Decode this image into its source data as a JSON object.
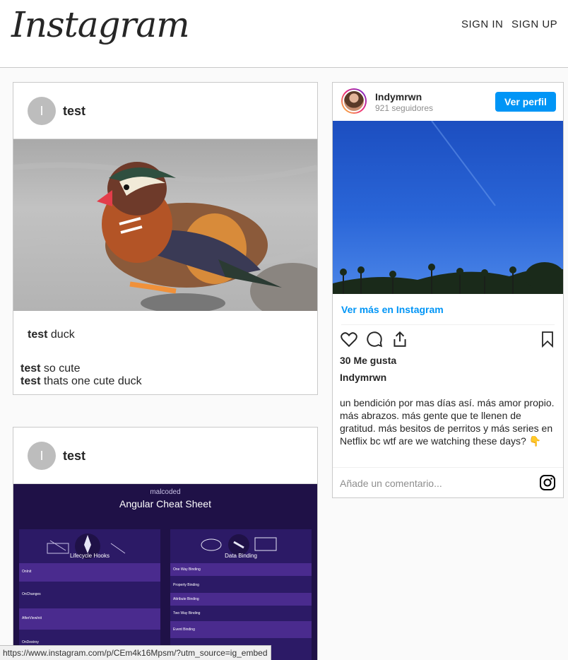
{
  "header": {
    "logo": "Instagram",
    "sign_in": "SIGN IN",
    "sign_up": "SIGN UP"
  },
  "posts": [
    {
      "avatar_letter": "I",
      "username": "test",
      "image_icon": "mandarin-duck-photo",
      "caption": {
        "user": "test",
        "text": " duck"
      },
      "comments": [
        {
          "user": "test",
          "text": " so cute"
        },
        {
          "user": "test",
          "text": " thats one cute duck"
        }
      ]
    },
    {
      "avatar_letter": "I",
      "username": "test",
      "sheet": {
        "brand": "malcoded",
        "title": "Angular Cheat Sheet",
        "left_heading": "Lifecycle Hooks",
        "right_heading": "Data Binding",
        "left_rows": [
          "OnInit",
          "OnChanges",
          "AfterViewInit",
          "OnDestroy"
        ],
        "right_rows": [
          "One Way Binding",
          "Property Binding",
          "Attribute Binding",
          "Two Way Binding",
          "Event Binding"
        ]
      }
    }
  ],
  "embed": {
    "username": "Indymrwn",
    "followers": "921 seguidores",
    "view_profile": "Ver perfil",
    "view_more": "Ver más en Instagram",
    "likes": "30 Me gusta",
    "caption_user": "Indymrwn",
    "caption_text": "un bendición por mas días así. más amor propio. más abrazos. más gente que te llenen de gratitud. más besitos de perritos y más series en Netflix bc wtf are we watching these days? 👇",
    "comment_placeholder": "Añade un comentario..."
  },
  "status_url": "https://www.instagram.com/p/CEm4k16Mpsm/?utm_source=ig_embed"
}
